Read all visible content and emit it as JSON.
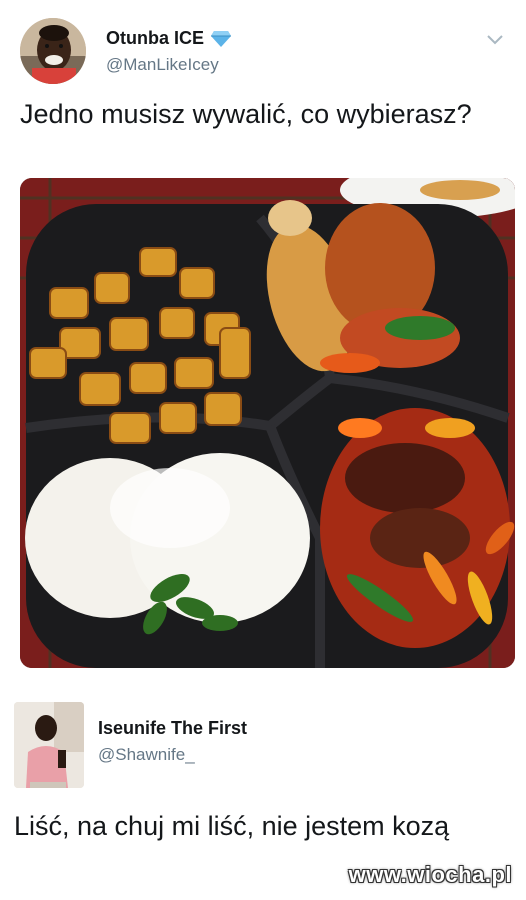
{
  "tweet": {
    "display_name": "Otunba ICE",
    "verified_icon": "diamond-icon",
    "handle": "@ManLikeIcey",
    "text": "Jedno musisz wywalić, co wybierasz?",
    "menu_icon": "chevron-down-icon"
  },
  "photo": {
    "icon": "food-plate-photo"
  },
  "reply": {
    "display_name": "Iseunife The First",
    "handle": "@Shawnife_",
    "text": "Liść, na chuj mi liść, nie jestem kozą"
  },
  "watermark": "www.wiocha.pl",
  "colors": {
    "text_primary": "#14171a",
    "text_secondary": "#657786",
    "verified": "#5bb3e8"
  }
}
